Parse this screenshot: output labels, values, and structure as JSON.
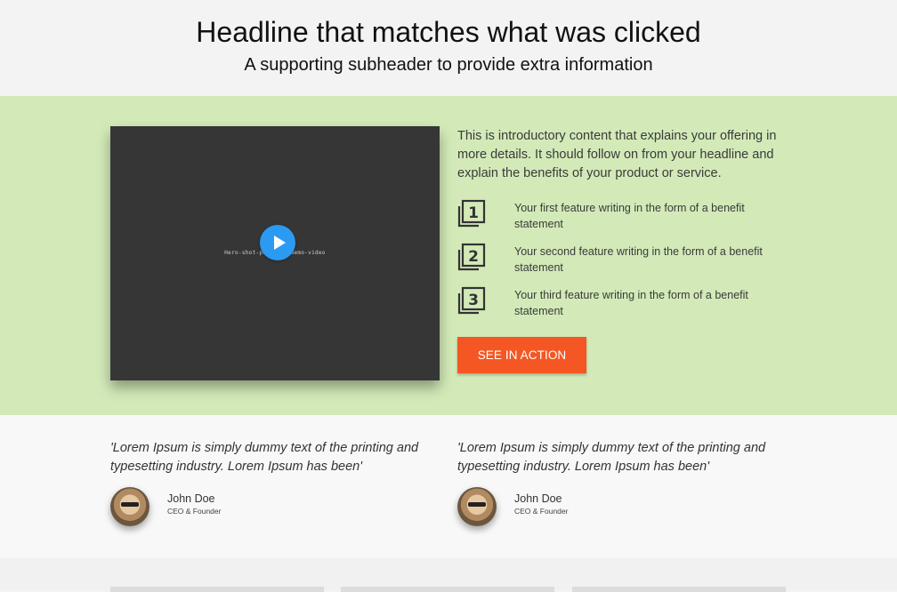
{
  "header": {
    "title": "Headline that matches what was clicked",
    "subtitle": "A supporting subheader to provide extra information"
  },
  "hero": {
    "video": {
      "caption": "Hero-shot-photo-or-demo-video",
      "play_icon": "play-icon",
      "play_color": "#2b9af3"
    },
    "intro": "This is introductory content that explains your offering in more details. It should follow on from your headline and explain the benefits of your product or service.",
    "features": [
      {
        "icon": "number-1-icon",
        "num": "1",
        "text": "Your first feature writing in the form of a benefit statement"
      },
      {
        "icon": "number-2-icon",
        "num": "2",
        "text": "Your second feature writing in the form of a benefit statement"
      },
      {
        "icon": "number-3-icon",
        "num": "3",
        "text": "Your third feature writing in the form of a benefit statement"
      }
    ],
    "cta_label": "SEE IN ACTION",
    "background": "#d3eab8",
    "cta_color": "#f45723"
  },
  "testimonials": [
    {
      "quote": "'Lorem Ipsum is simply dummy text of the printing and typesetting industry. Lorem Ipsum has been'",
      "name": "John Doe",
      "role": "CEO & Founder"
    },
    {
      "quote": "'Lorem Ipsum is simply dummy text of the printing and typesetting industry. Lorem Ipsum has been'",
      "name": "John Doe",
      "role": "CEO & Founder"
    }
  ]
}
